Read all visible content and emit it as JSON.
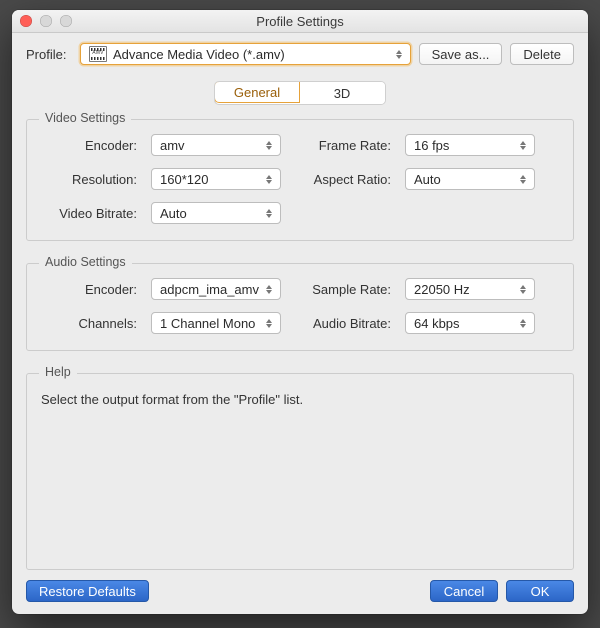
{
  "window": {
    "title": "Profile Settings"
  },
  "profile": {
    "label": "Profile:",
    "icon_label": "AMV",
    "selected": "Advance Media Video (*.amv)",
    "save_as": "Save as...",
    "delete": "Delete"
  },
  "tabs": {
    "general": "General",
    "threeD": "3D",
    "active": "general"
  },
  "video": {
    "title": "Video Settings",
    "encoder_label": "Encoder:",
    "encoder": "amv",
    "resolution_label": "Resolution:",
    "resolution": "160*120",
    "video_bitrate_label": "Video Bitrate:",
    "video_bitrate": "Auto",
    "frame_rate_label": "Frame Rate:",
    "frame_rate": "16 fps",
    "aspect_ratio_label": "Aspect Ratio:",
    "aspect_ratio": "Auto"
  },
  "audio": {
    "title": "Audio Settings",
    "encoder_label": "Encoder:",
    "encoder": "adpcm_ima_amv",
    "channels_label": "Channels:",
    "channels": "1 Channel Mono",
    "sample_rate_label": "Sample Rate:",
    "sample_rate": "22050 Hz",
    "audio_bitrate_label": "Audio Bitrate:",
    "audio_bitrate": "64 kbps"
  },
  "help": {
    "title": "Help",
    "text": "Select the output format from the \"Profile\" list."
  },
  "footer": {
    "restore": "Restore Defaults",
    "cancel": "Cancel",
    "ok": "OK"
  }
}
